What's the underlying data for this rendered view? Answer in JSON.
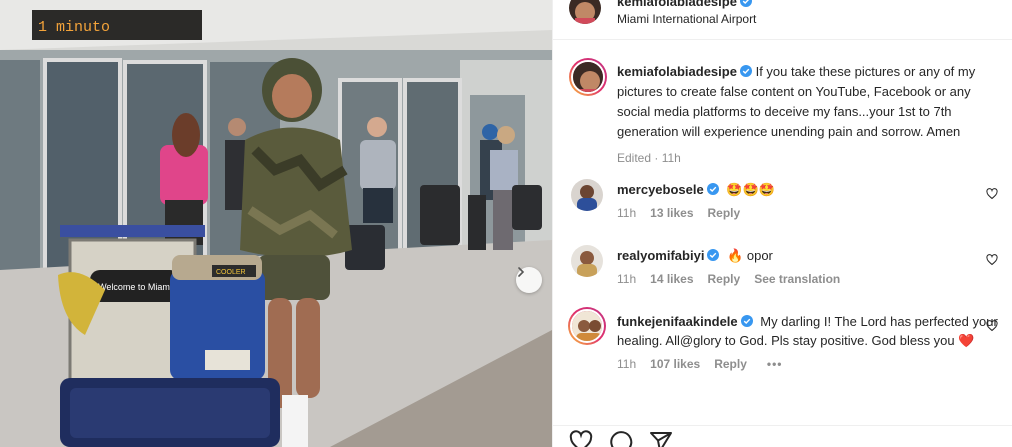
{
  "post": {
    "username": "kemiafolabiadesipe",
    "location": "Miami International Airport"
  },
  "photo": {
    "description": "",
    "sign_text": "1 minuto",
    "cart_sign": "Welcome to Miami",
    "bag_label": "COOLER"
  },
  "caption": {
    "username": "kemiafolabiadesipe",
    "text": "If you take these pictures or any of my pictures to create false content on YouTube, Facebook or any social media platforms to deceive my fans...your 1st to 7th generation will experience unending pain and sorrow. Amen",
    "meta": "Edited · 11h"
  },
  "comments": [
    {
      "username": "mercyebosele",
      "text": "🤩🤩🤩",
      "time": "11h",
      "likes": "13 likes",
      "reply": "Reply"
    },
    {
      "username": "realyomifabiyi",
      "text": "🔥 opor",
      "time": "11h",
      "likes": "14 likes",
      "reply": "Reply",
      "translate": "See translation"
    },
    {
      "username": "funkejenifaakindele",
      "text": "My darling I! The Lord has perfected your healing. All@glory to God. Pls stay positive. God bless you ❤️",
      "time": "11h",
      "likes": "107 likes",
      "reply": "Reply",
      "more": "•••"
    }
  ],
  "colors": {
    "verified": "#3897f0",
    "muted": "#8e8e8e",
    "text": "#262626",
    "heart": "#ed4956"
  },
  "icons": [
    "verified-badge-icon",
    "like-heart-icon",
    "comment-icon",
    "share-icon",
    "chevron-right-icon"
  ]
}
